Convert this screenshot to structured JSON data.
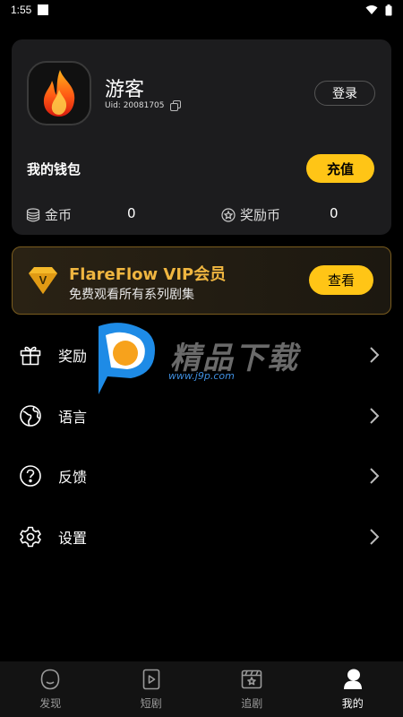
{
  "status_bar": {
    "time": "1:55"
  },
  "profile": {
    "username": "游客",
    "uid": "Uid: 20081705",
    "login_label": "登录",
    "wallet_label": "我的钱包",
    "recharge_label": "充值",
    "coins_label": "金币",
    "coins_value": "0",
    "reward_label": "奖励币",
    "reward_value": "0"
  },
  "vip": {
    "badge_letter": "V",
    "title": "FlareFlow VIP会员",
    "subtitle": "免费观看所有系列剧集",
    "button_label": "查看"
  },
  "menu": {
    "items": [
      {
        "label": "奖励",
        "icon": "gift-icon"
      },
      {
        "label": "语言",
        "icon": "globe-icon"
      },
      {
        "label": "反馈",
        "icon": "question-icon"
      },
      {
        "label": "设置",
        "icon": "gear-icon"
      }
    ]
  },
  "watermark": {
    "text": "精品下载",
    "url": "www.j9p.com"
  },
  "tab_bar": {
    "tabs": [
      {
        "label": "发现",
        "icon": "discover-icon"
      },
      {
        "label": "短剧",
        "icon": "play-file-icon"
      },
      {
        "label": "追剧",
        "icon": "star-clapper-icon"
      },
      {
        "label": "我的",
        "icon": "profile-icon",
        "active": true
      }
    ]
  },
  "colors": {
    "accent": "#ffc516",
    "vip_gold": "#f0b640",
    "card_bg": "#1c1c1e"
  }
}
